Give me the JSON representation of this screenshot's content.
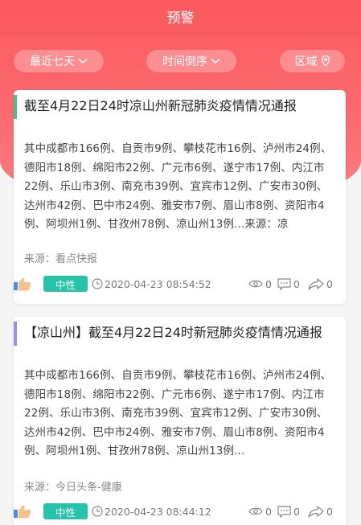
{
  "header": {
    "title": "预警"
  },
  "filters": {
    "range": "最近七天",
    "order": "时间倒序",
    "region": "区域"
  },
  "colors": {
    "header_red": "#fb5a5f",
    "tag_green": "#25c3a8",
    "card1_accent": "#3cc48a",
    "card2_accent": "#9b8ef2"
  },
  "cards": [
    {
      "title": "截至4月22日24时凉山州新冠肺炎疫情情况通报",
      "body": "其中成都市166例、自贡市9例、攀枝花市16例、泸州市24例、德阳市18例、绵阳市22例、广元市6例、遂宁市17例、内江市22例、乐山市3例、南充市39例、宜宾市12例、广安市30例、达州市42例、巴中市24例、雅安市7例、眉山市8例、资阳市4例、阿坝州1例、甘孜州78例、凉山州13例...来源：凉",
      "source": "来源：看点快报",
      "tag": "中性",
      "time": "2020-04-23 08:54:52",
      "views": "0",
      "comments": "0",
      "shares": "0"
    },
    {
      "title": "【凉山州】截至4月22日24时新冠肺炎疫情情况通报",
      "body": "其中成都市166例、自贡市9例、攀枝花市16例、泸州市24例、德阳市18例、绵阳市22例、广元市6例、遂宁市17例、内江市22例、乐山市3例、南充市39例、宜宾市12例、广安市30例、达州市42例、巴中市24例、雅安市7例、眉山市8例、资阳市4例、阿坝州1例、甘孜州78例、凉山州13例...",
      "source": "来源：今日头条-健康",
      "tag": "中性",
      "time": "2020-04-23 08:44:12",
      "views": "0",
      "comments": "0",
      "shares": "0"
    }
  ]
}
